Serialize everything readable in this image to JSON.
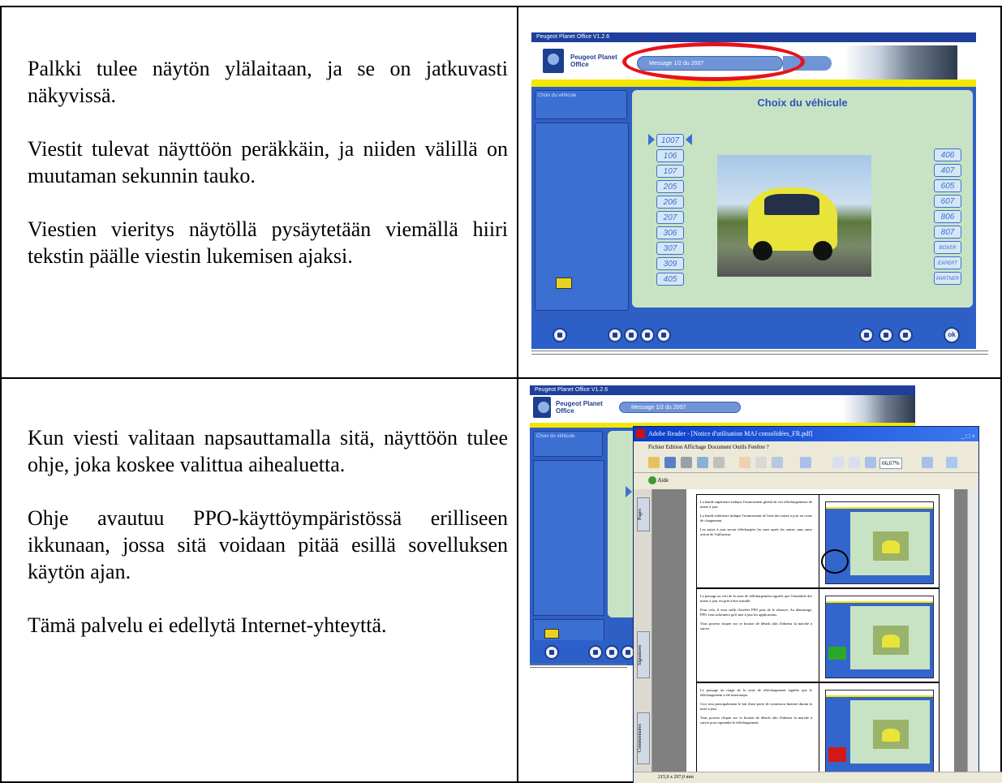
{
  "rows": [
    {
      "paragraphs": [
        "Palkki tulee näytön ylälaitaan, ja se on jatkuvasti näkyvissä.",
        "Viestit tulevat näyttöön peräkkäin, ja niiden välillä on muutaman sekunnin tauko.",
        "Viestien vieritys näytöllä pysäytetään viemällä hiiri tekstin päälle viestin lukemisen ajaksi."
      ],
      "screenshot": {
        "window_title": "Peugeot Planet Office V1.2.6",
        "brand_line1": "Peugeot Planet",
        "brand_line2": "Office",
        "logo_text": "Peugeot",
        "message_bar": "Message 1/2 du 2007",
        "sidebar_button": "Choix du véhicule",
        "panel_title": "Choix du véhicule",
        "models_left": [
          "1007",
          "106",
          "107",
          "205",
          "206",
          "207",
          "306",
          "307",
          "309",
          "405"
        ],
        "models_right": [
          "406",
          "407",
          "605",
          "607",
          "806",
          "807",
          "BOXER",
          "EXPERT",
          "PARTNER"
        ],
        "bottom_ok": "ok"
      }
    },
    {
      "paragraphs": [
        "Kun viesti valitaan napsauttamalla sitä, näyttöön tulee ohje, joka koskee valittua aihealuetta.",
        "Ohje avautuu PPO-käyttöympäristössä erilliseen ikkunaan, jossa sitä voidaan pitää esillä sovelluksen käytön ajan.",
        "Tämä palvelu ei edellytä Internet-yhteyttä."
      ],
      "screenshot": {
        "window_title": "Peugeot Planet Office V1.2.6",
        "brand_line1": "Peugeot Planet",
        "brand_line2": "Office",
        "message_bar": "Message 1/2 du 2007",
        "sidebar_button": "Choix du véhicule",
        "adobe_title": "Adobe Reader - [Notice d'utilisation MAJ consolidées_FR.pdf]",
        "adobe_menu": "Fichier  Edition  Affichage  Document  Outils  Fenêtre  ?",
        "zoom": "66,67%",
        "aide": "Aide",
        "tab_pages": "Pages",
        "tab_signatures": "Signatures",
        "tab_comments": "Commentaires",
        "status": "215,9 x 297,0 mm",
        "doc_rows": [
          [
            "La bande supérieure indique l'avancement global de vos téléchargements de mises à jour.",
            "La bande inférieure indique l'avancement de l'une des mises à jour en cours de chargement.",
            "Les mises à jour seront téléchargées les unes après les autres, sans autre action de l'utilisateur."
          ],
          [
            "Le passage au vert de la zone de téléchargement signifie que l'ensemble des mises à jour est prêt à être installé.",
            "Pour cela, il vous suffit d'arrêter PPO puis de le relancer. Au démarrage, PPO vous informera qu'il met à jour les applications.",
            "Vous pouvez cliquer sur ce bouton de détails afin d'obtenir la marche à suivre."
          ],
          [
            "Le passage au rouge de la zone de téléchargement signifie que le téléchargement a été interrompu.",
            "Ceci sera principalement le fait d'une perte de connexion Internet durant la mise à jour.",
            "Vous pouvez cliquer sur ce bouton de détails afin d'obtenir la marche à suivre pour reprendre le téléchargement."
          ]
        ]
      }
    }
  ]
}
